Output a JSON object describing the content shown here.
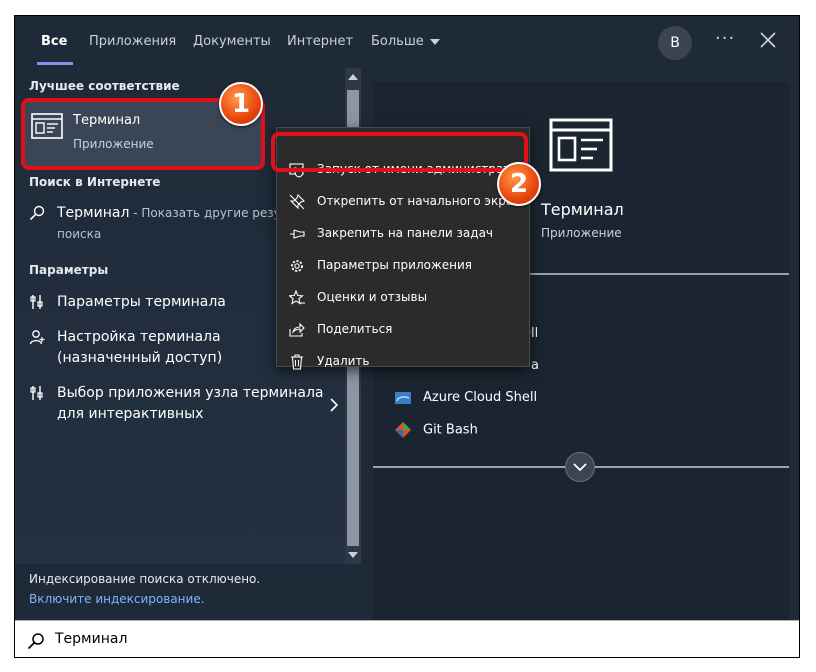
{
  "tabs": [
    {
      "label": "Все"
    },
    {
      "label": "Приложения"
    },
    {
      "label": "Документы"
    },
    {
      "label": "Интернет"
    },
    {
      "label": "Больше"
    }
  ],
  "avatar": "B",
  "more_dots": "···",
  "best_match": {
    "section": "Лучшее соответствие",
    "title": "Терминал",
    "subtitle": "Приложение"
  },
  "web": {
    "section": "Поиск в Интернете",
    "query": "Терминал",
    "suffix": " - Показать другие результаты поиска"
  },
  "settings": {
    "section": "Параметры",
    "items": [
      {
        "label": "Параметры терминала"
      },
      {
        "label": "Настройка терминала (назначенный доступ)"
      },
      {
        "label": "Выбор приложения узла терминала для интерактивных"
      }
    ]
  },
  "footer": {
    "status": "Индексирование поиска отключено.",
    "link": "Включите индексирование."
  },
  "search": {
    "value": "Терминал"
  },
  "context_menu": [
    {
      "label": "Запуск от имени администратора",
      "icon": "shield-icon"
    },
    {
      "label": "Открепить от начального экрана",
      "icon": "unpin-icon"
    },
    {
      "label": "Закрепить на панели задач",
      "icon": "pin-icon"
    },
    {
      "label": "Параметры приложения",
      "icon": "gear-icon"
    },
    {
      "label": "Оценки и отзывы",
      "icon": "star-icon"
    },
    {
      "label": "Поделиться",
      "icon": "share-icon"
    },
    {
      "label": "Удалить",
      "icon": "trash-icon"
    }
  ],
  "preview": {
    "title": "Терминал",
    "subtitle": "Приложение",
    "partial_items": [
      "ell",
      "a"
    ],
    "items": [
      {
        "label": "Azure Cloud Shell",
        "icon": "azure-icon"
      },
      {
        "label": "Git Bash",
        "icon": "git-icon"
      }
    ]
  },
  "annotations": [
    "1",
    "2"
  ],
  "colors": {
    "highlight": "#e0101a",
    "accent": "#8a8ee8",
    "link": "#7cb6ff"
  }
}
